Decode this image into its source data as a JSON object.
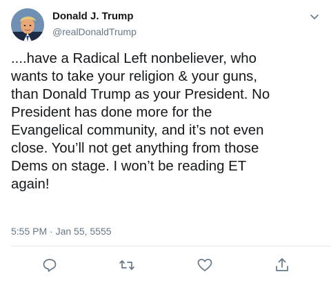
{
  "tweet": {
    "author_name": "Donald J. Trump",
    "author_handle": "@realDonaldTrump",
    "text": "....have a Radical Left nonbeliever, who\nwants to take your religion & your guns,\nthan Donald Trump as your President. No\nPresident has done more for the\nEvangelical community, and it’s not even\nclose. You’ll not get anything from those\nDems on stage. I won’t be reading ET\nagain!",
    "timestamp": "5:55 PM · Jan 55, 5555"
  },
  "icons": {
    "avatar": "profile-photo",
    "menu": "chevron-down-icon",
    "reply": "reply-icon",
    "retweet": "retweet-icon",
    "like": "heart-icon",
    "share": "share-icon"
  },
  "colors": {
    "text": "#14171a",
    "secondary_text": "#657786",
    "icon": "#657786",
    "divider": "#e6ecf0",
    "background": "#ffffff"
  }
}
